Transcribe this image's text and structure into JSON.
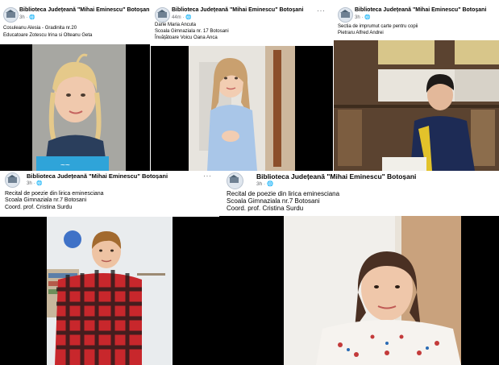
{
  "page_name": "Biblioteca Județeană \"Mihai Eminescu\" Botoșani",
  "globe_icon": "globe-icon",
  "more_icon": "more-options-icon",
  "posts": [
    {
      "time": "3h",
      "lines": [
        "Cosuleanu Alesia - Gradinita nr.20",
        "Educatoare Zotescu Irina si Olteanu Geta"
      ]
    },
    {
      "time": "44m",
      "lines": [
        "Darie Maria Ancuta",
        "Scoala Gimnaziala nr. 17 Botosani",
        "Învățătoare Voicu Oana Anca"
      ]
    },
    {
      "time": "3h",
      "lines": [
        "Sectia de imprumut carte pentru copii",
        "Pietraru Alfred Andrei"
      ]
    },
    {
      "time": "3h",
      "lines": [
        "Recital de poezie din lirica eminesciana",
        "Scoala Gimnaziala nr.7 Botosani",
        "Coord. prof. Cristina Surdu"
      ]
    },
    {
      "time": "3h",
      "lines": [
        "Recital de poezie din lirica eminesciana",
        "Scoala Gimnaziala nr.7 Botosani",
        "Coord. prof. Cristina Surdu"
      ]
    }
  ],
  "colors": {
    "text": "#050505",
    "meta": "#65676b",
    "video_bg": "#000000"
  }
}
